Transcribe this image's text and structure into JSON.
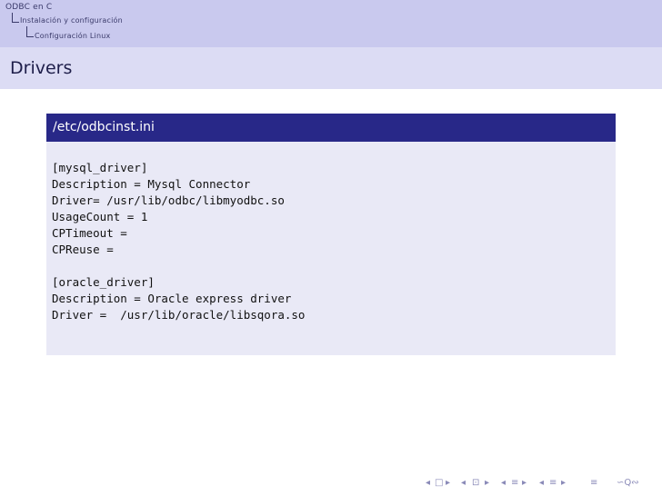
{
  "breadcrumb": {
    "section": "ODBC en C",
    "subsection": "Instalación y configuración",
    "subsubsection": "Configuración Linux"
  },
  "frame": {
    "title": "Drivers"
  },
  "block": {
    "title": "/etc/odbcinst.ini",
    "lines": [
      "[mysql_driver]",
      "Description = Mysql Connector",
      "Driver= /usr/lib/odbc/libmyodbc.so",
      "UsageCount = 1",
      "CPTimeout =",
      "CPReuse =",
      "",
      "[oracle_driver]",
      "Description = Oracle express driver",
      "Driver =  /usr/lib/oracle/libsqora.so"
    ]
  },
  "navigation": {
    "icons": [
      "first-frame-icon",
      "frame-icon",
      "prev-frame-icon",
      "slide-icon",
      "next-frame-icon",
      "prev-subsection-icon",
      "subsection-icon",
      "next-subsection-icon",
      "prev-section-icon",
      "section-icon",
      "next-section-icon",
      "align-icon",
      "search-icon"
    ]
  },
  "colors": {
    "header_bg": "#c9c9ee",
    "title_bg": "#dcdcf4",
    "block_head_bg": "#282888",
    "block_body_bg": "#e9e9f6"
  }
}
